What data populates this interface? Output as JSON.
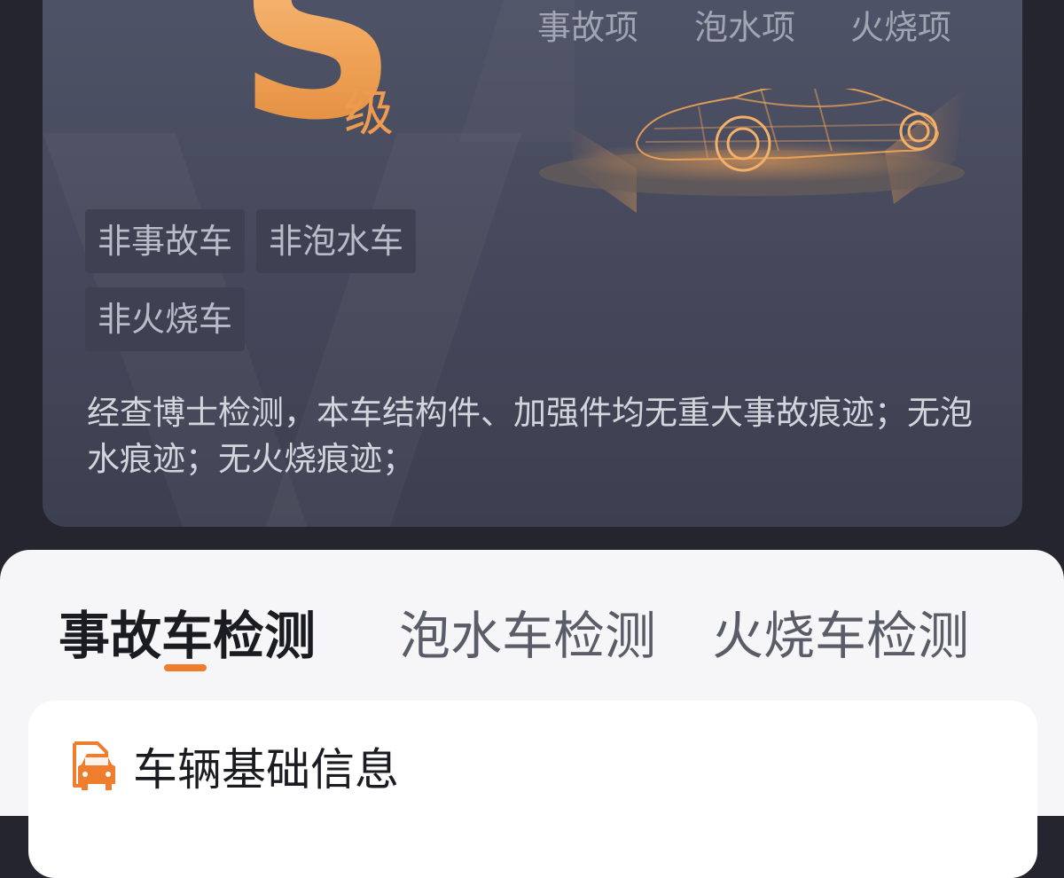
{
  "report": {
    "grade_letter": "S",
    "grade_suffix": "级",
    "check_items": [
      "事故项",
      "泡水项",
      "火烧项"
    ],
    "tags": [
      "非事故车",
      "非泡水车",
      "非火烧车"
    ],
    "summary": "经查博士检测，本车结构件、加强件均无重大事故痕迹；无泡水痕迹；无火烧痕迹；"
  },
  "tabs": [
    {
      "label": "事故车检测",
      "active": true
    },
    {
      "label": "泡水车检测",
      "active": false
    },
    {
      "label": "火烧车检测",
      "active": false
    }
  ],
  "section": {
    "title": "车辆基础信息",
    "icon": "car-document-icon"
  },
  "colors": {
    "accent": "#ee7d2e",
    "grade_gradient": [
      "#f8c48a",
      "#e08a3c"
    ],
    "card_bg": "#4a4d60",
    "page_bg": "#25252f"
  }
}
